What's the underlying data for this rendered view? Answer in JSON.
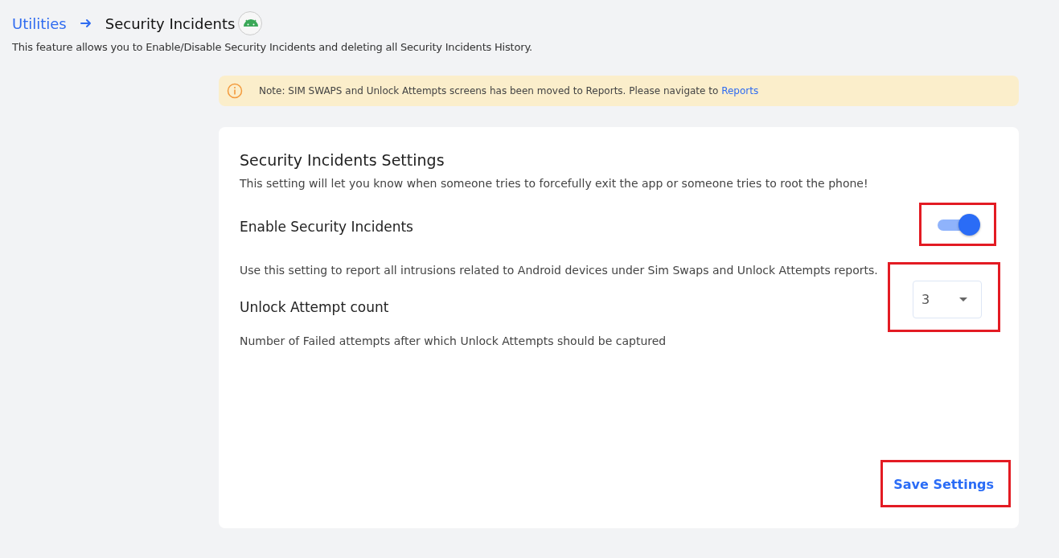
{
  "breadcrumb": {
    "parent": "Utilities",
    "current": "Security Incidents"
  },
  "description": "This feature allows you to Enable/Disable Security Incidents and deleting all Security Incidents History.",
  "notice": {
    "text": "Note: SIM SWAPS and Unlock Attempts screens has been moved to Reports. Please navigate to ",
    "link": "Reports"
  },
  "card": {
    "title": "Security Incidents Settings",
    "subtitle": "This setting will let you know when someone tries to forcefully exit the app or someone tries to root the phone!",
    "settings": [
      {
        "kind": "toggle",
        "label": "Enable Security Incidents",
        "on": true,
        "highlighted": true,
        "help": "Use this setting to report all intrusions related to Android devices under Sim Swaps and Unlock Attempts reports."
      },
      {
        "kind": "select",
        "label": "Unlock Attempt count",
        "value": "3",
        "highlighted": true,
        "help": "Number of Failed attempts after which Unlock Attempts should be captured"
      }
    ],
    "save_button": {
      "label": "Save Settings",
      "highlighted": true
    }
  }
}
